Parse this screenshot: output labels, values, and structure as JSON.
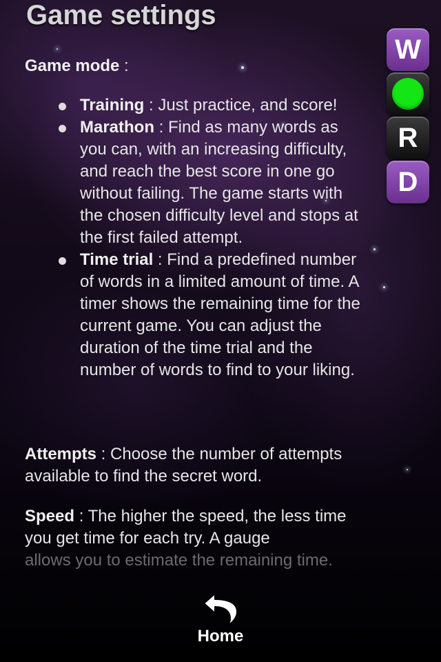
{
  "header": {
    "title": "Game settings"
  },
  "game_mode": {
    "label": "Game mode",
    "separator": " :",
    "items": [
      {
        "name": "Training",
        "desc": " : Just practice, and score!"
      },
      {
        "name": "Marathon",
        "desc": " : Find as many words as you can, with an increasing difficulty, and reach the best score in one go without failing. The game starts with the chosen difficulty level and stops at the first failed attempt."
      },
      {
        "name": "Time trial",
        "desc": " : Find a predefined number of words in a limited amount of time. A timer shows the remaining time for the current game. You can adjust the duration of the time trial and the number of words to find to your liking."
      }
    ]
  },
  "attempts": {
    "label": "Attempts",
    "desc": " : Choose the number of attempts available to find the secret word."
  },
  "speed": {
    "label": "Speed",
    "desc": " : The higher the speed, the less time you get time for each try. A gauge",
    "desc_faded": "allows you to estimate the remaining time."
  },
  "logo": {
    "letters": [
      "W",
      "",
      "R",
      "D"
    ],
    "dot_color": "#14e514"
  },
  "nav": {
    "home_label": "Home",
    "home_icon": "back-arrow-icon"
  }
}
